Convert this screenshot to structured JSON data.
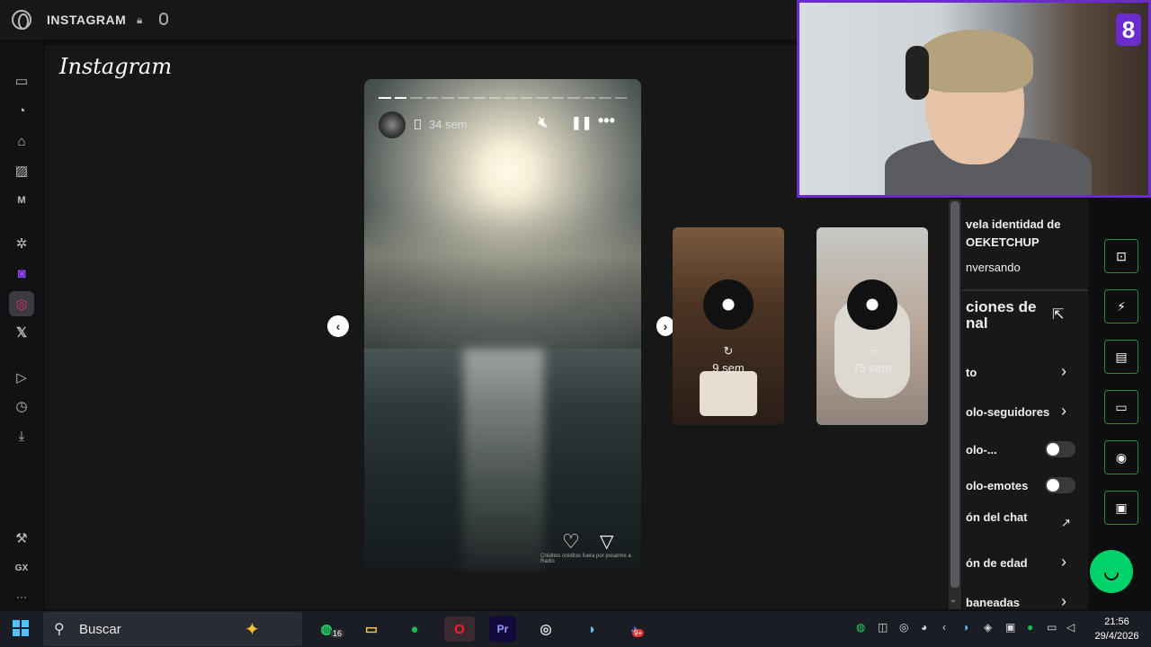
{
  "browser": {
    "tab_title": "INSTAGRAM",
    "lock_icon": "lock-icon",
    "mic_icon": "mic-icon"
  },
  "sidebar": {
    "items": [
      "gamepad-icon",
      "speed-dial-icon",
      "cleaner-icon",
      "tabs-icon",
      "player-icon",
      "chatgpt-icon",
      "twitch-icon",
      "instagram-icon",
      "x-icon",
      "send-icon",
      "history-icon",
      "downloads-icon",
      "mods-icon",
      "gx-label",
      "more-icon"
    ],
    "gx_label": "GX",
    "more_label": "···"
  },
  "instagram": {
    "logo": "Instagram",
    "story": {
      "time": "34 sem",
      "segments": 16,
      "viewed": 2,
      "credits": "Créditos créditos fuera por posarme a Radio"
    },
    "previews": [
      {
        "time": "9 sem"
      },
      {
        "time": "75 sem"
      }
    ]
  },
  "chat_panel": {
    "title_line1": "vela identidad de",
    "title_line2": "OEKETCHUP",
    "subtitle": "nversando",
    "settings_title": "ciones de",
    "settings_title2": "nal",
    "rows": [
      {
        "label": "to",
        "control": "chevron"
      },
      {
        "label": "olo-seguidores",
        "control": "chevron"
      },
      {
        "label": "olo-...",
        "control": "toggle"
      },
      {
        "label": "olo-emotes",
        "control": "toggle"
      },
      {
        "label": "ón del chat",
        "control": "external"
      },
      {
        "label": "ón de edad",
        "control": "chevron"
      },
      {
        "label": "baneadas",
        "control": "chevron"
      }
    ]
  },
  "webcam": {
    "overlay_number": "8"
  },
  "taskbar": {
    "search_label": "Buscar",
    "whatsapp_badge": "16",
    "discord_badge": "9+",
    "clock_time": "21:56",
    "clock_date": "29/4/2026",
    "apps": [
      "whatsapp-icon",
      "file-explorer-icon",
      "spotify-icon",
      "opera-gx-icon",
      "premiere-icon",
      "obs-icon",
      "steam-icon",
      "discord-icon"
    ]
  }
}
